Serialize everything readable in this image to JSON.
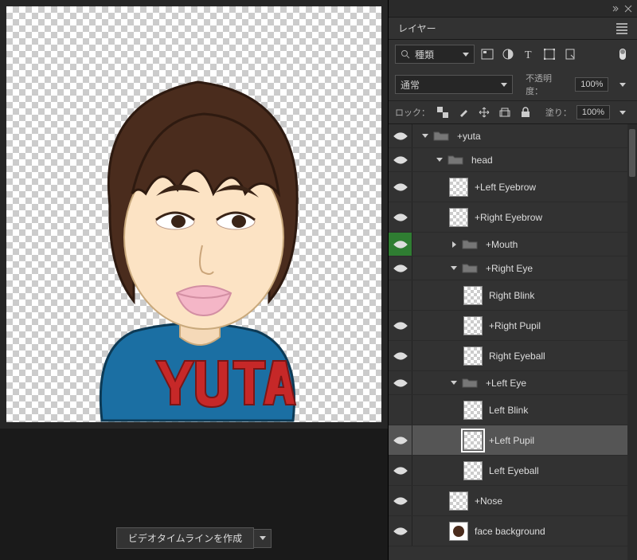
{
  "panel": {
    "title": "レイヤー"
  },
  "filter": {
    "label": "種類"
  },
  "blend": {
    "mode": "通常",
    "opacity_label": "不透明度：",
    "opacity_value": "100%"
  },
  "lock": {
    "label": "ロック：",
    "fill_label": "塗り：",
    "fill_value": "100%"
  },
  "timeline": {
    "button": "ビデオタイムラインを作成"
  },
  "layers": [
    {
      "id": "yuta",
      "indent": 0,
      "type": "folder",
      "name": "+yuta",
      "vis": true,
      "expand": "down"
    },
    {
      "id": "head",
      "indent": 1,
      "type": "folder",
      "name": "head",
      "vis": true,
      "expand": "down"
    },
    {
      "id": "leb",
      "indent": 2,
      "type": "layer",
      "name": "+Left Eyebrow",
      "vis": true
    },
    {
      "id": "reb",
      "indent": 2,
      "type": "layer",
      "name": "+Right Eyebrow",
      "vis": true
    },
    {
      "id": "mouth",
      "indent": 2,
      "type": "folder",
      "name": "+Mouth",
      "vis": true,
      "expand": "right",
      "hi": true
    },
    {
      "id": "reye",
      "indent": 2,
      "type": "folder",
      "name": "+Right Eye",
      "vis": true,
      "expand": "down"
    },
    {
      "id": "rblink",
      "indent": 3,
      "type": "layer",
      "name": "Right Blink",
      "vis": false
    },
    {
      "id": "rpupil",
      "indent": 3,
      "type": "layer",
      "name": "+Right Pupil",
      "vis": true
    },
    {
      "id": "rball",
      "indent": 3,
      "type": "layer",
      "name": "Right Eyeball",
      "vis": true
    },
    {
      "id": "leye",
      "indent": 2,
      "type": "folder",
      "name": "+Left Eye",
      "vis": true,
      "expand": "down"
    },
    {
      "id": "lblink",
      "indent": 3,
      "type": "layer",
      "name": "Left Blink",
      "vis": false
    },
    {
      "id": "lpupil",
      "indent": 3,
      "type": "layer",
      "name": "+Left Pupil",
      "vis": true,
      "selected": true
    },
    {
      "id": "lball",
      "indent": 3,
      "type": "layer",
      "name": "Left Eyeball",
      "vis": true
    },
    {
      "id": "nose",
      "indent": 2,
      "type": "layer",
      "name": "+Nose",
      "vis": true
    },
    {
      "id": "facebg",
      "indent": 2,
      "type": "face",
      "name": "face background",
      "vis": true
    }
  ]
}
